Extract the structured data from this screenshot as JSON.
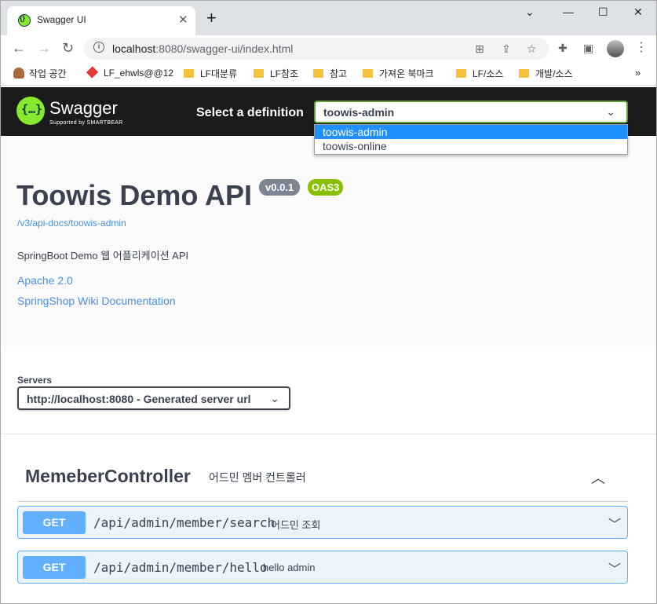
{
  "browser": {
    "tab_title": "Swagger UI",
    "tab_close": "✕",
    "new_tab": "+",
    "window_controls": {
      "minimize": "—",
      "maximize": "☐",
      "close": "✕",
      "collapse": "⌄"
    },
    "url_host": "localhost",
    "url_rest": ":8080/swagger-ui/index.html",
    "bookmarks": [
      {
        "label": "작업 공간",
        "icon": "person-icon"
      },
      {
        "label": "LF_ehwls@@12",
        "icon": "red-extension-icon"
      },
      {
        "label": "LF대분류",
        "icon": "folder-icon"
      },
      {
        "label": "LF참조",
        "icon": "folder-icon"
      },
      {
        "label": "참고",
        "icon": "folder-icon"
      },
      {
        "label": "가져온 북마크",
        "icon": "folder-icon"
      },
      {
        "label": "LF/소스",
        "icon": "folder-icon"
      },
      {
        "label": "개발/소스",
        "icon": "folder-icon"
      }
    ],
    "bookmarks_more": "»"
  },
  "swagger": {
    "brand": "Swagger",
    "brand_sub": "Supported by SMARTBEAR",
    "select_definition_label": "Select a definition",
    "selected_definition": "toowis-admin",
    "definition_options": [
      "toowis-admin",
      "toowis-online"
    ]
  },
  "info": {
    "title": "Toowis Demo API",
    "version": "v0.0.1",
    "oas": "OAS3",
    "doc_url": "/v3/api-docs/toowis-admin",
    "description": "SpringBoot Demo 웹 어플리케이션 API",
    "license_link": "Apache 2.0",
    "external_docs_link": "SpringShop Wiki Documentation"
  },
  "servers": {
    "label": "Servers",
    "selected": "http://localhost:8080 - Generated server url"
  },
  "controller": {
    "name": "MemeberController",
    "description": "어드민 멤버 컨트롤러",
    "operations": [
      {
        "method": "GET",
        "path": "/api/admin/member/search",
        "summary": "어드민 조회"
      },
      {
        "method": "GET",
        "path": "/api/admin/member/hello",
        "summary": "hello admin"
      }
    ]
  },
  "colors": {
    "swagger_green": "#85ea2d",
    "topbar": "#1b1b1b",
    "get_blue": "#61affe",
    "link_blue": "#4990e2",
    "version_badge": "#7d8492",
    "oas_badge": "#89bf04"
  }
}
